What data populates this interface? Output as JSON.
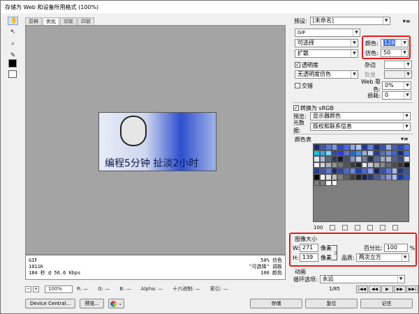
{
  "window": {
    "title": "存储为 Web 和设备所用格式 (100%)"
  },
  "tools": [
    "hand-icon",
    "slice-select-icon",
    "zoom-icon",
    "eyedropper-icon"
  ],
  "tabs": [
    {
      "label": "原稿",
      "active": false
    },
    {
      "label": "优化",
      "active": true
    },
    {
      "label": "双联",
      "active": false
    },
    {
      "label": "四联",
      "active": false
    }
  ],
  "preview": {
    "caption": "编程5分钟 扯淡2小时"
  },
  "info": {
    "left": [
      "GIF",
      "1011K",
      "184 秒 @ 56.6 Kbps"
    ],
    "right": [
      "50% 仿色",
      "\"可选择\" 调板",
      "100 颜色"
    ]
  },
  "status": {
    "zoom": "100%",
    "r": "R: —",
    "g": "G: —",
    "b": "B: —",
    "alpha": "Alpha: —",
    "hex": "十六进制: —",
    "index": "索引: —"
  },
  "buttons": {
    "device_central": "Device Central...",
    "preview": "预览...",
    "save": "存储",
    "reset": "复位",
    "remember": "记住"
  },
  "settings": {
    "preset_label": "预设:",
    "preset_value": "[未命名]",
    "format": "GIF",
    "palette": "可选择",
    "dither_algo": "扩散",
    "colors_label": "颜色:",
    "colors_value": "128",
    "dither_label": "仿色:",
    "dither_value": "50",
    "transparency_label": "透明度",
    "matte_label": "杂边",
    "trans_dither": "无透明度仿色",
    "amount_label": "数量",
    "interlaced_label": "交错",
    "web_snap_label": "Web 靠色:",
    "web_snap_value": "0%",
    "lossy_label": "损耗:",
    "lossy_value": "0",
    "convert_srgb_label": "转换为 sRGB",
    "preview_label": "预览:",
    "preview_value": "显示器颜色",
    "metadata_label": "元数据:",
    "metadata_value": "版权和联系信息"
  },
  "color_table": {
    "title": "颜色表",
    "count": "100",
    "colors": [
      "#1a2a6a",
      "#3a5ab8",
      "#5a7ad8",
      "#7a9ae8",
      "#2a4ac8",
      "#4a6af0",
      "#90a8f0",
      "#b8c8f8",
      "#1838a8",
      "#6080e0",
      "#203080",
      "#3050d0",
      "#a0b0e0",
      "#4060c0",
      "#2848b8",
      "#5070e8",
      "#18c0d8",
      "#38a8f0",
      "#80d8f8",
      "#3848a0",
      "#2838e8",
      "#6870c8",
      "#1870c8",
      "#4890e8",
      "#98b0d8",
      "#c0d0f0",
      "#283890",
      "#5870b0",
      "#7090d8",
      "#3868d8",
      "#202870",
      "#4878f0",
      "#e0e8f8",
      "#a8b8d8",
      "#606880",
      "#303848",
      "#181c28",
      "#405070",
      "#8898c0",
      "#c8d0e8",
      "#70809a",
      "#283048",
      "#5868a0",
      "#9aa8d0",
      "#b0b8cc",
      "#506090",
      "#3a4a78",
      "#d8e0f0",
      "#f0f0f4",
      "#d0d4dc",
      "#b0b4bc",
      "#909498",
      "#707478",
      "#505458",
      "#383c40",
      "#202428",
      "#e8e8ec",
      "#c8ccd4",
      "#a8acb4",
      "#888c90",
      "#686c70",
      "#484c50",
      "#303438",
      "#101418",
      "#283c90",
      "#4058b0",
      "#6078d0",
      "#1c2c60",
      "#3048a0",
      "#5068c8",
      "#7088e0",
      "#2040b0",
      "#4868d8",
      "#88a0e8",
      "#182458",
      "#3050b8",
      "#5878e0",
      "#a8b8e8",
      "#203878",
      "#385898",
      "#000000",
      "#ffffff",
      "#e0e0e0",
      "#c0c0c0",
      "#808080",
      "#606060",
      "#404040",
      "#202020",
      "#102050",
      "#2a3a70",
      "#4a5a90",
      "#6a7ab0",
      "#8a9ad0",
      "#aabaf0",
      "#1a3a9a",
      "#3a5aca",
      "#7e7e7e",
      "#7e7e7e",
      "#ffffff",
      "#fafafa"
    ]
  },
  "image_size": {
    "title": "图像大小",
    "w_label": "W:",
    "w_value": "271",
    "h_label": "H:",
    "h_value": "139",
    "unit": "像素",
    "percent_label": "百分比:",
    "percent_value": "100",
    "percent_unit": "%",
    "quality_label": "品质:",
    "quality_value": "两次立方"
  },
  "animation": {
    "title": "动画",
    "loop_label": "循环选项:",
    "loop_value": "永远",
    "frame_counter": "1/85"
  },
  "colors": {
    "highlight_red": "#e41b1b",
    "selection_blue": "#3a6fd8"
  }
}
